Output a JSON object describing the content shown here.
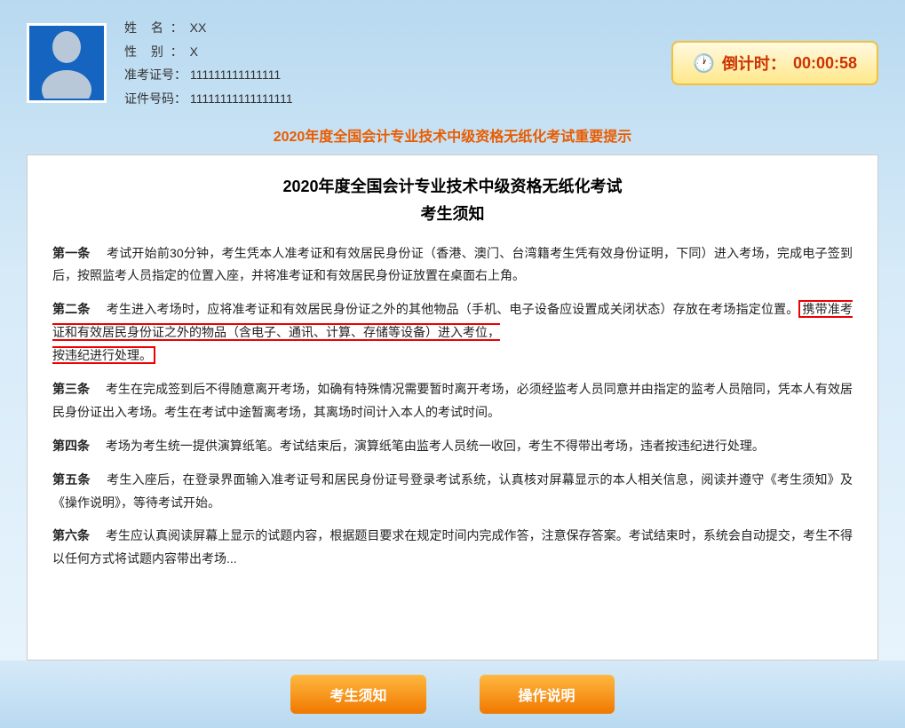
{
  "header": {
    "name_label": "姓",
    "name_label2": "名",
    "name_value": "XX",
    "gender_label": "性",
    "gender_label2": "别",
    "gender_value": "X",
    "admission_label": "准考证号：",
    "admission_value": "111111111111111",
    "id_label": "证件号码：",
    "id_value": "11111111111111111"
  },
  "timer": {
    "label": "倒计时：",
    "value": "00:00:58"
  },
  "main_title": "2020年度全国会计专业技术中级资格无纸化考试重要提示",
  "doc": {
    "title_line1": "2020年度全国会计专业技术中级资格无纸化考试",
    "title_line2": "考生须知",
    "articles": [
      {
        "id": "第一条",
        "content": "考试开始前30分钟，考生凭本人准考证和有效居民身份证（香港、澳门、台湾籍考生凭有效身份证明，下同）进入考场，完成电子签到后，按照监考人员指定的位置入座，并将准考证和有效居民身份证放置在桌面右上角。"
      },
      {
        "id": "第二条",
        "content_before": "考生进入考场时，应将准考证和有效居民身份证之外的其他物品（手机、电子设备应设置成关闭状态）存放在考场指定位置。",
        "content_highlight": "携带准考证和有效居民身份证之外的物品（含电子、通讯、计算、存储等设备）进入考位，按违纪进行处理。",
        "content_after": ""
      },
      {
        "id": "第三条",
        "content": "考生在完成签到后不得随意离开考场，如确有特殊情况需要暂时离开考场，必须经监考人员同意并由指定的监考人员陪同，凭本人有效居民身份证出入考场。考生在考试中途暂离考场，其离场时间计入本人的考试时间。"
      },
      {
        "id": "第四条",
        "content": "考场为考生统一提供演算纸笔。考试结束后，演算纸笔由监考人员统一收回，考生不得带出考场，违者按违纪进行处理。"
      },
      {
        "id": "第五条",
        "content": "考生入座后，在登录界面输入准考证号和居民身份证号登录考试系统，认真核对屏幕显示的本人相关信息，阅读并遵守《考生须知》及《操作说明》，等待考试开始。"
      },
      {
        "id": "第六条",
        "content": "考生应认真阅读屏幕上显示的试题内容，根据题目要求在规定时间内完成作答..."
      }
    ]
  },
  "buttons": {
    "btn1": "考生须知",
    "btn2": "操作说明"
  }
}
